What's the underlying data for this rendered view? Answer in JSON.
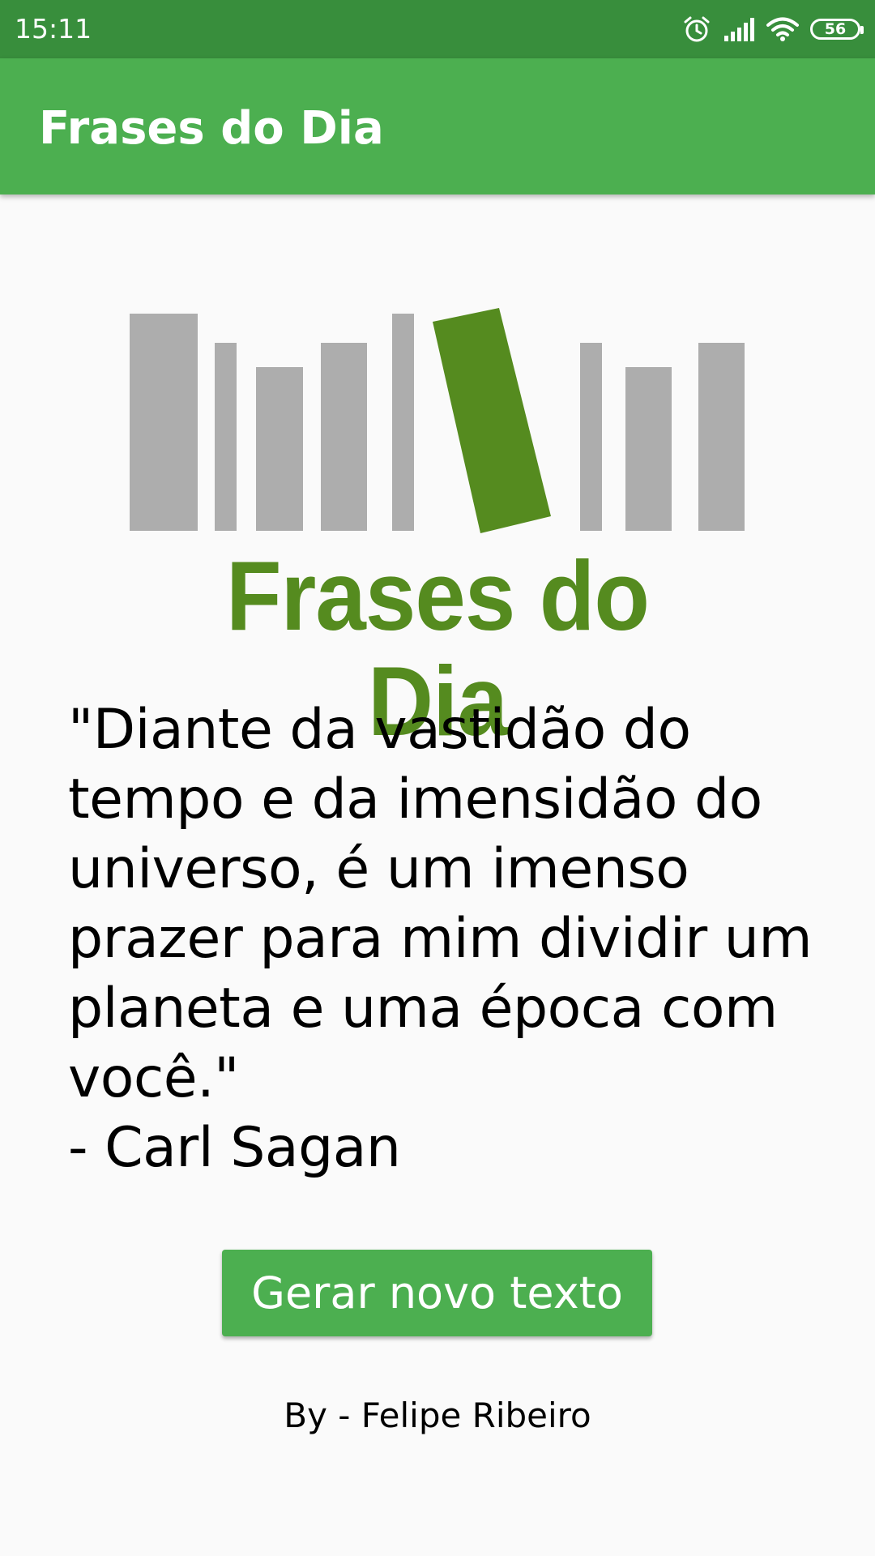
{
  "status_bar": {
    "time": "15:11",
    "battery": "56",
    "icons": [
      "alarm-icon",
      "cell-signal-icon",
      "wifi-icon",
      "battery-icon"
    ]
  },
  "app_bar": {
    "title": "Frases do Dia"
  },
  "logo": {
    "wordmark": "Frases do Dia",
    "colors": {
      "books_gray": "#adadad",
      "accent_green": "#558b1f"
    }
  },
  "quote": {
    "lines": [
      "\"Diante da vastidão do",
      "tempo e da imensidão do",
      "universo, é um imenso",
      "prazer para mim dividir um",
      "planeta e uma época com",
      "você.\""
    ],
    "author": "- Carl Sagan"
  },
  "actions": {
    "generate_label": "Gerar novo texto"
  },
  "footer": {
    "credit": "By - Felipe Ribeiro"
  },
  "theme": {
    "primary": "#4caf50",
    "primary_dark": "#388e3c",
    "background": "#fafafa"
  }
}
